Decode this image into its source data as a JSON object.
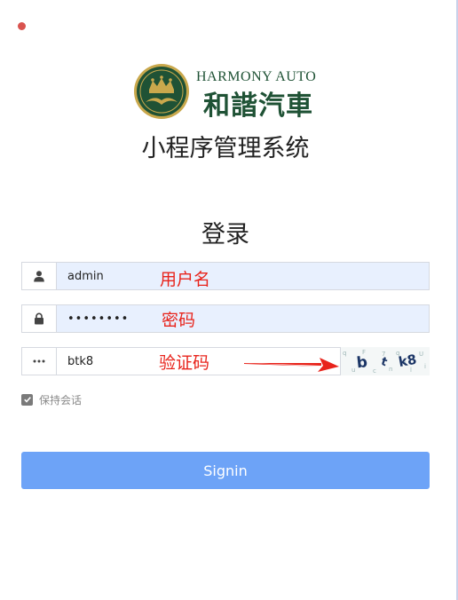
{
  "brand": {
    "name_en": "HARMONY AUTO",
    "name_cn": "和諧汽車"
  },
  "app_title": "小程序管理系统",
  "login": {
    "heading": "登录",
    "username": {
      "value": "admin",
      "icon": "user-icon"
    },
    "password": {
      "value": "••••••••",
      "icon": "lock-icon"
    },
    "captcha_input": {
      "value": "btk8",
      "icon": "ellipsis-icon"
    },
    "captcha_image_text": "b t k8",
    "remember_label": "保持会话",
    "remember_checked": true,
    "signin_label": "Signin"
  },
  "annotations": {
    "username": "用户名",
    "password": "密码",
    "captcha": "验证码"
  },
  "colors": {
    "brand_green": "#1f5235",
    "brand_gold": "#c9a84c",
    "button_blue": "#6da3f7",
    "annotation_red": "#e8231b",
    "autofill_bg": "#e8f0fe"
  }
}
